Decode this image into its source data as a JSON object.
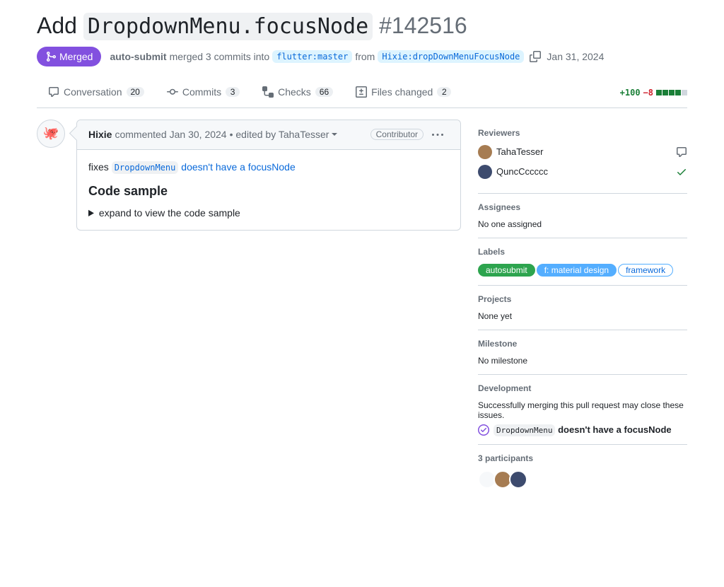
{
  "title": {
    "prefix": "Add ",
    "code": "DropdownMenu.focusNode",
    "number": "#142516"
  },
  "state": "Merged",
  "meta": {
    "author": "auto-submit",
    "action_prefix": " merged 3 commits into ",
    "base_branch": "flutter:master",
    "from_text": " from ",
    "head_branch": "Hixie:dropDownMenuFocusNode",
    "date": "Jan 31, 2024"
  },
  "tabs": {
    "conversation": {
      "label": "Conversation",
      "count": "20"
    },
    "commits": {
      "label": "Commits",
      "count": "3"
    },
    "checks": {
      "label": "Checks",
      "count": "66"
    },
    "files": {
      "label": "Files changed",
      "count": "2"
    }
  },
  "diff": {
    "additions": "+100",
    "deletions": "−8"
  },
  "comment": {
    "author": "Hixie",
    "action": " commented ",
    "date": "Jan 30, 2024",
    "edited": " • edited by TahaTesser",
    "badge": "Contributor",
    "body_prefix": "fixes ",
    "body_link_code": "DropdownMenu",
    "body_link_suffix": " doesn't have a focusNode",
    "heading": "Code sample",
    "details_summary": "expand to view the code sample"
  },
  "sidebar": {
    "reviewers_heading": "Reviewers",
    "reviewers": [
      {
        "name": "TahaTesser",
        "status": "comment"
      },
      {
        "name": "QuncCccccc",
        "status": "approved"
      }
    ],
    "assignees_heading": "Assignees",
    "assignees_text": "No one assigned",
    "labels_heading": "Labels",
    "labels": [
      {
        "name": "autosubmit",
        "bg": "#2da44e",
        "fg": "#ffffff",
        "border": "#2da44e"
      },
      {
        "name": "f: material design",
        "bg": "#54aeff",
        "fg": "#ffffff",
        "border": "#54aeff"
      },
      {
        "name": "framework",
        "bg": "#ffffff",
        "fg": "#0969da",
        "border": "#54aeff"
      }
    ],
    "projects_heading": "Projects",
    "projects_text": "None yet",
    "milestone_heading": "Milestone",
    "milestone_text": "No milestone",
    "development_heading": "Development",
    "development_text": "Successfully merging this pull request may close these issues.",
    "development_issue_code": "DropdownMenu",
    "development_issue_suffix": " doesn't have a focusNode",
    "participants_heading": "3 participants"
  }
}
